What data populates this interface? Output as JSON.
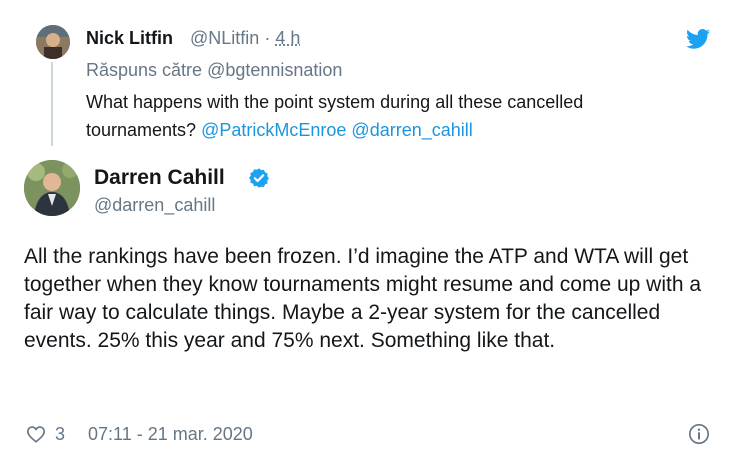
{
  "reply": {
    "author_name": "Nick Litfin",
    "author_handle": "@NLitfin",
    "time_separator": "·",
    "time_ago": "4 h",
    "replying_to_label": "Răspuns către",
    "replying_to_handle": "@bgtennisnation",
    "text": "What happens with the point system during all these cancelled tournaments?",
    "mention_1": "@PatrickMcEnroe",
    "mention_2": "@darren_cahill"
  },
  "main": {
    "author_name": "Darren Cahill",
    "author_handle": "@darren_cahill",
    "verified": true,
    "text": "All the rankings have been frozen. I’d imagine the ATP and WTA will get together when they know tournaments might resume and come up with a fair way to calculate things.  Maybe a 2-year system for the cancelled events. 25% this year and 75% next. Something like that."
  },
  "footer": {
    "like_count": "3",
    "timestamp": "07:11 - 21 mar. 2020",
    "like_icon": "heart-icon",
    "info_icon": "info-icon"
  },
  "colors": {
    "accent": "#1b95e0",
    "muted": "#657786",
    "text": "#14171a",
    "thread_line": "#ccd6dd"
  }
}
